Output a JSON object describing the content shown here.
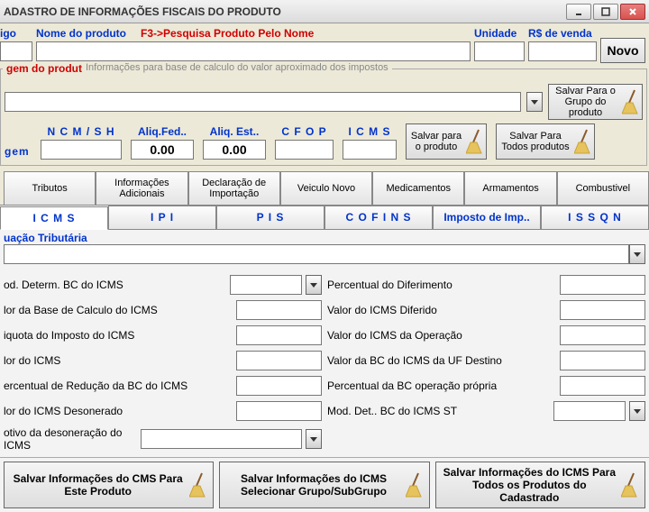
{
  "window": {
    "title": "ADASTRO DE INFORMAÇÕES FISCAIS DO PRODUTO"
  },
  "top": {
    "codigo": "igo",
    "nome": "Nome do produto",
    "pesquisa": "F3->Pesquisa Produto Pelo Nome",
    "unidade": "Unidade",
    "rs_venda": "R$ de venda",
    "novo": "Novo"
  },
  "group": {
    "origem_prefix": "gem  do produto",
    "info_title": "Informações para base de calculo do valor aproximado dos impostos",
    "salvar_grupo": "Salvar Para o Grupo do produto",
    "gem_label": "gem",
    "cols": {
      "ncmsh": "N C M / S H",
      "fed": "Aliq.Fed..",
      "est": "Aliq. Est..",
      "cfop": "C F O P",
      "icms": "I C M S"
    },
    "vals": {
      "fed": "0.00",
      "est": "0.00"
    },
    "salvar_produto": "Salvar  para o produto",
    "salvar_todos": "Salvar Para Todos produtos"
  },
  "maintabs": [
    "Tributos",
    "Informações Adicionais",
    "Declaração de Importação",
    "Veiculo Novo",
    "Medicamentos",
    "Armamentos",
    "Combustivel"
  ],
  "subtabs": [
    "I C M S",
    "I P I",
    "P I S",
    "C O F I N S",
    "Imposto de Imp..",
    "I S S Q N"
  ],
  "situ": {
    "label": "uação Tributária"
  },
  "left_fields": {
    "mod_bc": "od. Determ. BC do ICMS",
    "valor_base": "lor da Base de Calculo do ICMS",
    "aliquota": "iquota do Imposto do ICMS",
    "valor_icms": "lor do ICMS",
    "perc_red": "ercentual de Redução da BC do ICMS",
    "valor_deson": "lor do ICMS Desonerado",
    "motivo": "otivo da desoneração do ICMS"
  },
  "right_fields": {
    "perc_dif": "Percentual do Diferimento",
    "valor_dif": "Valor do ICMS Diferido",
    "valor_op": "Valor do ICMS da Operação",
    "valor_bc_uf": "Valor da BC do ICMS da UF Destino",
    "perc_bc_op": "Percentual da BC operação própria",
    "mod_det_st": "Mod. Det.. BC do ICMS ST"
  },
  "bottom": {
    "b1": "Salvar Informações do CMS Para Este Produto",
    "b2": "Salvar Informações do ICMS Selecionar Grupo/SubGrupo",
    "b3": "Salvar Informações do ICMS Para Todos os Produtos do Cadastrado"
  }
}
